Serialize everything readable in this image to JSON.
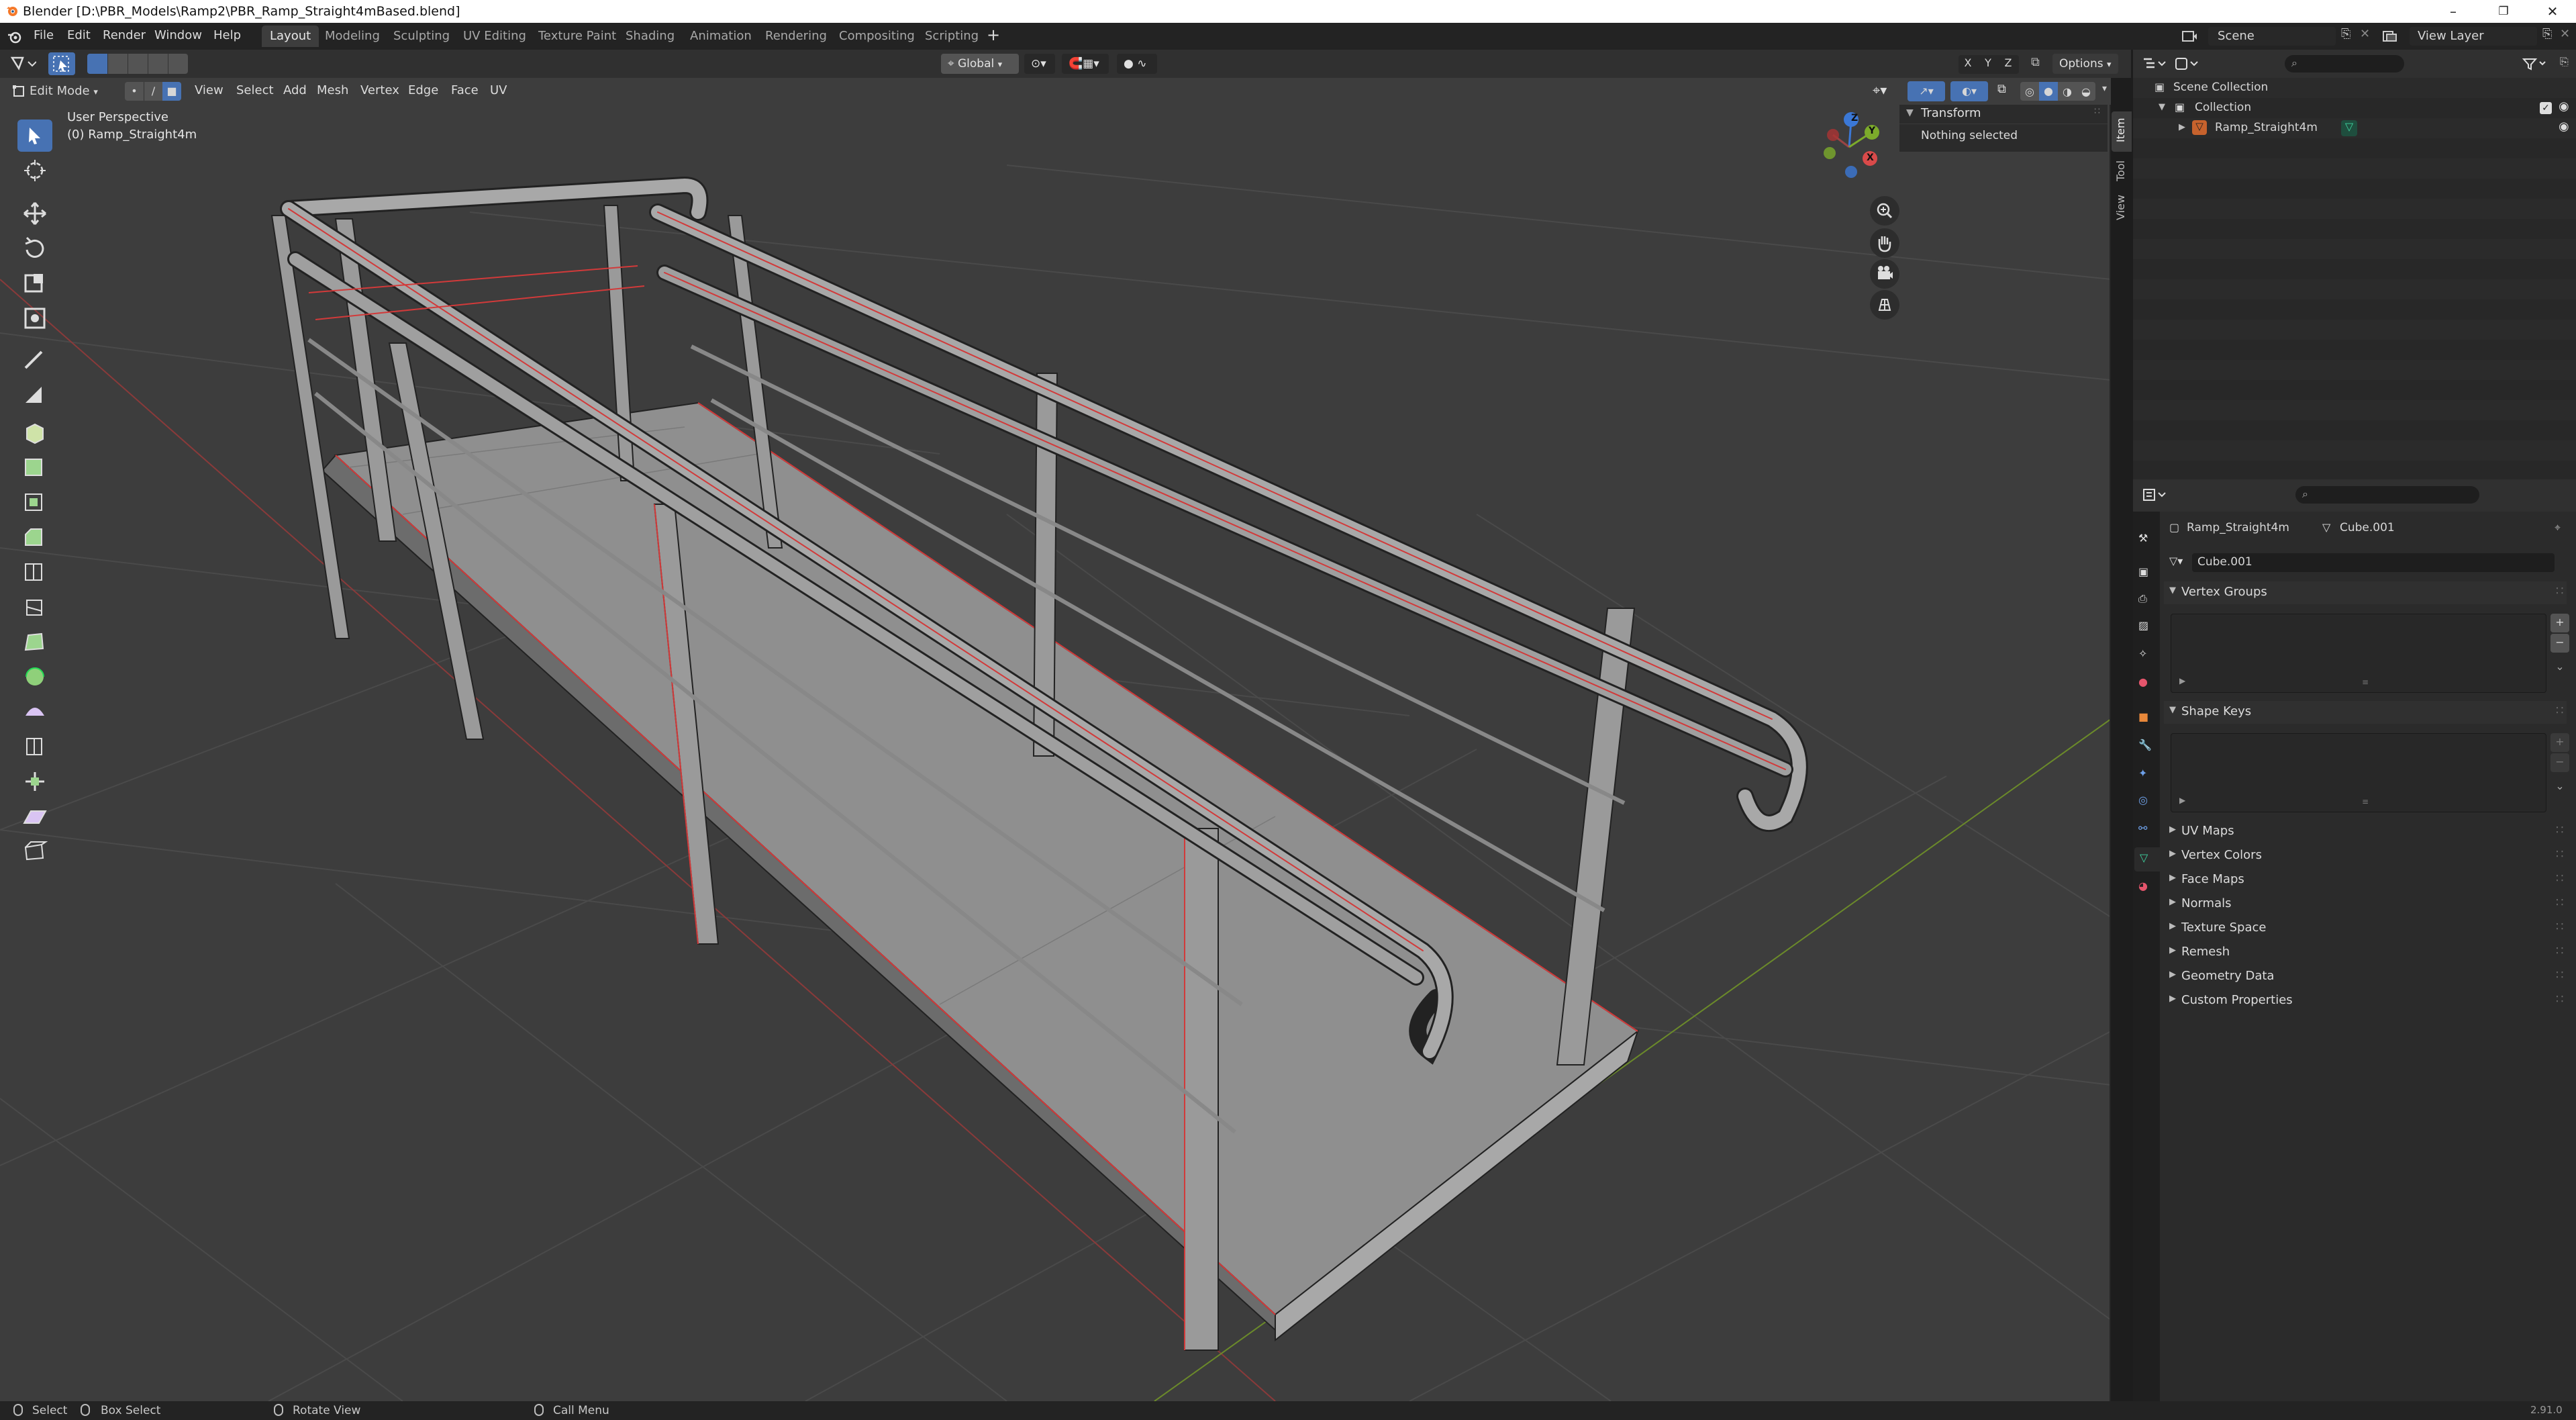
{
  "window": {
    "title": "Blender [D:\\PBR_Models\\Ramp2\\PBR_Ramp_Straight4mBased.blend]",
    "controls": [
      "–",
      "❐",
      "✕"
    ]
  },
  "menu": [
    "File",
    "Edit",
    "Render",
    "Window",
    "Help"
  ],
  "workspaces": [
    "Layout",
    "Modeling",
    "Sculpting",
    "UV Editing",
    "Texture Paint",
    "Shading",
    "Animation",
    "Rendering",
    "Compositing",
    "Scripting"
  ],
  "active_workspace": "Layout",
  "scene": {
    "label": "Scene",
    "view_layer": "View Layer"
  },
  "viewport_header": {
    "transform_orientation": "Global",
    "options_label": "Options",
    "axis_buttons": [
      "X",
      "Y",
      "Z"
    ],
    "mode": "Edit Mode",
    "menus": [
      "View",
      "Select",
      "Add",
      "Mesh",
      "Vertex",
      "Edge",
      "Face",
      "UV"
    ]
  },
  "viewport": {
    "perspective_label": "User Perspective",
    "object_label": "(0) Ramp_Straight4m",
    "gizmo_axes": [
      "X",
      "Y",
      "Z"
    ]
  },
  "npanel": {
    "header": "Transform",
    "message": "Nothing selected",
    "tabs": [
      "Item",
      "Tool",
      "View"
    ]
  },
  "outliner": {
    "search_placeholder": "",
    "items": [
      {
        "label": "Scene Collection",
        "depth": 0
      },
      {
        "label": "Collection",
        "depth": 1
      },
      {
        "label": "Ramp_Straight4m",
        "depth": 2
      }
    ]
  },
  "properties": {
    "object_name": "Ramp_Straight4m",
    "mesh_name": "Cube.001",
    "data_field": "Cube.001",
    "sections": [
      {
        "label": "Vertex Groups",
        "expanded": true
      },
      {
        "label": "Shape Keys",
        "expanded": true
      },
      {
        "label": "UV Maps",
        "expanded": false
      },
      {
        "label": "Vertex Colors",
        "expanded": false
      },
      {
        "label": "Face Maps",
        "expanded": false
      },
      {
        "label": "Normals",
        "expanded": false
      },
      {
        "label": "Texture Space",
        "expanded": false
      },
      {
        "label": "Remesh",
        "expanded": false
      },
      {
        "label": "Geometry Data",
        "expanded": false
      },
      {
        "label": "Custom Properties",
        "expanded": false
      }
    ]
  },
  "statusbar": {
    "select": "Select",
    "box_select": "Box Select",
    "rotate_view": "Rotate View",
    "call_menu": "Call Menu",
    "version": "2.91.0"
  },
  "colors": {
    "accent": "#4772b3",
    "viewport_bg": "#3d3d3d",
    "seam": "#d23a3a",
    "x_axis": "#d94a4a",
    "y_axis": "#7cab2b",
    "z_axis": "#3b78d6"
  }
}
